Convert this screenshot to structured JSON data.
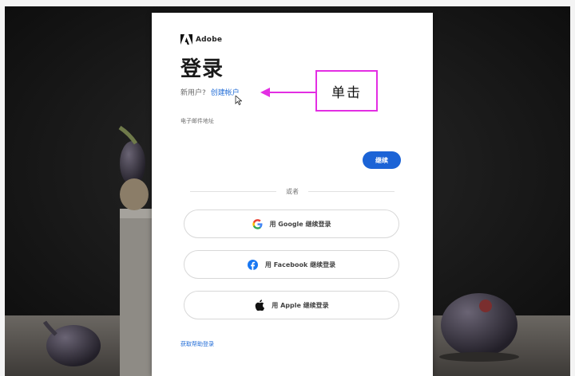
{
  "brand": {
    "name": "Adobe",
    "icon": "adobe-logo-icon"
  },
  "page": {
    "title": "登录"
  },
  "signup": {
    "question": "新用户?",
    "link": "创建帐户"
  },
  "form": {
    "email_label": "电子邮件地址",
    "continue_label": "继续"
  },
  "divider": {
    "text": "或者"
  },
  "social": [
    {
      "label": "用 Google 继续登录",
      "icon": "google-icon"
    },
    {
      "label": "用 Facebook 继续登录",
      "icon": "facebook-icon"
    },
    {
      "label": "用 Apple 继续登录",
      "icon": "apple-icon"
    }
  ],
  "help": {
    "link": "获取帮助登录"
  },
  "annotation": {
    "text": "单击",
    "color": "#e32ee3"
  },
  "colors": {
    "accent": "#1b63d6",
    "link": "#1f6bd6"
  }
}
